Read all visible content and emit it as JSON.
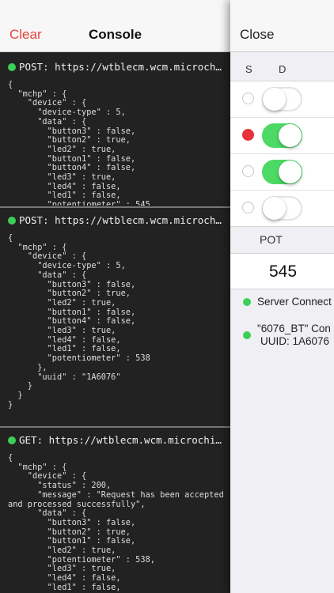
{
  "console": {
    "clear_label": "Clear",
    "title": "Console",
    "entries": [
      {
        "header": "POST: https://wtblecm.wcm.microch…",
        "body": "{\n  \"mchp\" : {\n    \"device\" : {\n      \"device-type\" : 5,\n      \"data\" : {\n        \"button3\" : false,\n        \"button2\" : true,\n        \"led2\" : true,\n        \"button1\" : false,\n        \"button4\" : false,\n        \"led3\" : true,\n        \"led4\" : false,\n        \"led1\" : false,\n        \"potentiometer\" : 545"
      },
      {
        "header": "POST: https://wtblecm.wcm.microch…",
        "body": "{\n  \"mchp\" : {\n    \"device\" : {\n      \"device-type\" : 5,\n      \"data\" : {\n        \"button3\" : false,\n        \"button2\" : true,\n        \"led2\" : true,\n        \"button1\" : false,\n        \"button4\" : false,\n        \"led3\" : true,\n        \"led4\" : false,\n        \"led1\" : false,\n        \"potentiometer\" : 538\n      },\n      \"uuid\" : \"1A6076\"\n    }\n  }\n}"
      },
      {
        "header": "GET: https://wtblecm.wcm.microchi…",
        "body": "{\n  \"mchp\" : {\n    \"device\" : {\n      \"status\" : 200,\n      \"message\" : \"Request has been accepted\nand processed successfully\",\n      \"data\" : {\n        \"button3\" : false,\n        \"button2\" : true,\n        \"button1\" : false,\n        \"led2\" : true,\n        \"potentiometer\" : 538,\n        \"led3\" : true,\n        \"led4\" : false,\n        \"led1\" : false,"
      }
    ]
  },
  "panel": {
    "close_label": "Close",
    "col_s": "S",
    "col_d": "D",
    "rows": [
      {
        "led_on": false,
        "toggle_on": false
      },
      {
        "led_on": true,
        "toggle_on": true
      },
      {
        "led_on": false,
        "toggle_on": true
      },
      {
        "led_on": false,
        "toggle_on": false
      }
    ],
    "pot_label": "POT",
    "pot_value": "545",
    "status": [
      {
        "line1": "Server Connect",
        "line2": ""
      },
      {
        "line1": "\"6076_BT\" Con",
        "line2": "UUID: 1A6076"
      }
    ]
  },
  "colors": {
    "accent_red": "#e8403c",
    "switch_green": "#4cd964",
    "status_green": "#3ccf57"
  }
}
